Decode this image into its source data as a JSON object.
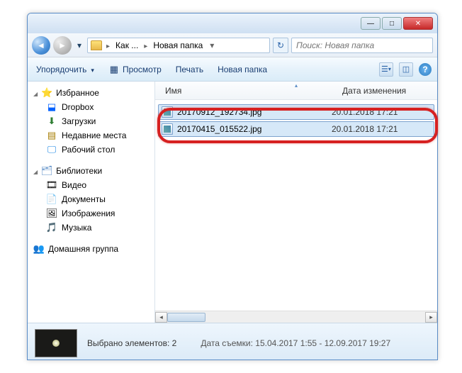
{
  "address": {
    "crumbs": [
      "Как ...",
      "Новая папка"
    ]
  },
  "search": {
    "placeholder": "Поиск: Новая папка"
  },
  "toolbar": {
    "organize": "Упорядочить",
    "preview": "Просмотр",
    "print": "Печать",
    "newfolder": "Новая папка"
  },
  "sidebar": {
    "favorites": {
      "label": "Избранное",
      "items": [
        "Dropbox",
        "Загрузки",
        "Недавние места",
        "Рабочий стол"
      ]
    },
    "libraries": {
      "label": "Библиотеки",
      "items": [
        "Видео",
        "Документы",
        "Изображения",
        "Музыка"
      ]
    },
    "homegroup": {
      "label": "Домашняя группа"
    }
  },
  "columns": {
    "name": "Имя",
    "date": "Дата изменения"
  },
  "files": [
    {
      "name": "20170912_192734.jpg",
      "date": "20.01.2018 17:21"
    },
    {
      "name": "20170415_015522.jpg",
      "date": "20.01.2018 17:21"
    }
  ],
  "status": {
    "selected": "Выбрано элементов: 2",
    "meta_label": "Дата съемки:",
    "meta_value": "15.04.2017 1:55 - 12.09.2017 19:27"
  }
}
